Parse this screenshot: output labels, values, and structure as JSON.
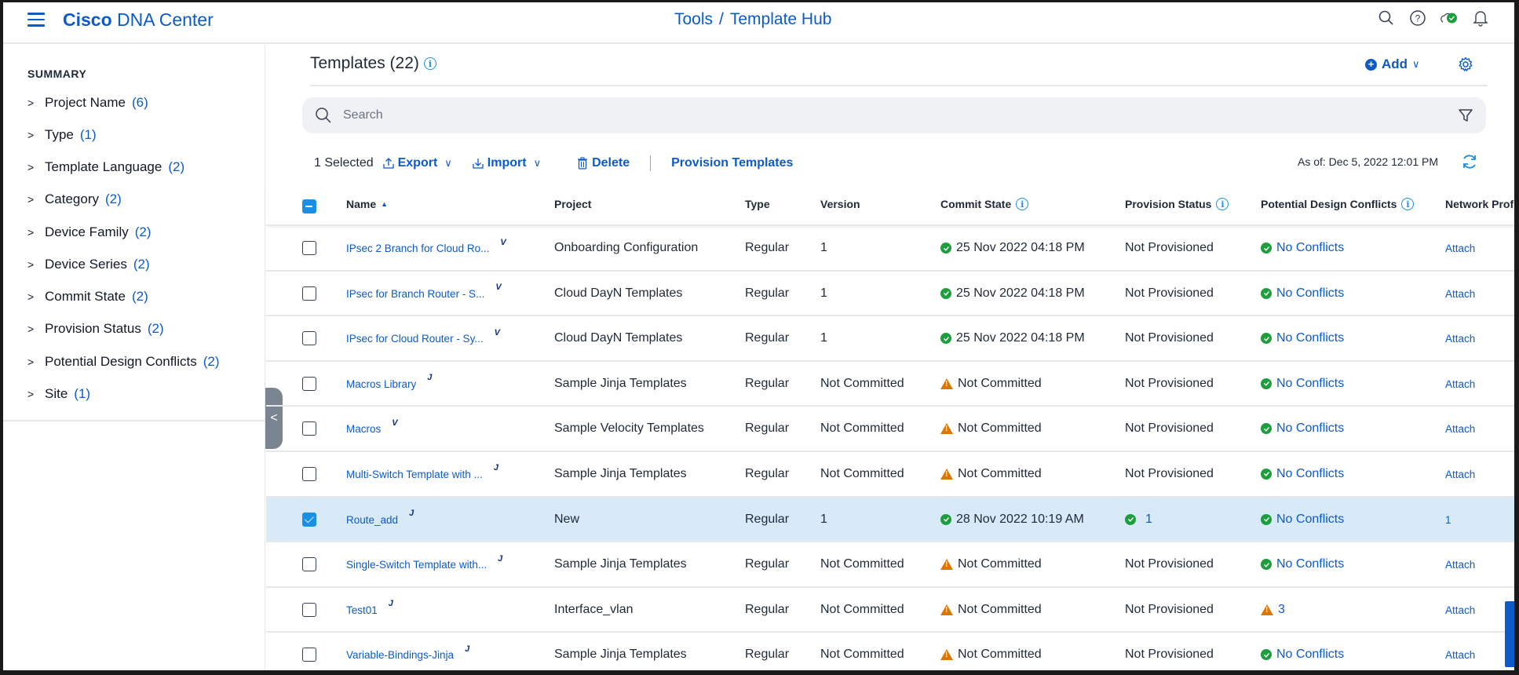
{
  "header": {
    "brand_bold": "Cisco",
    "brand_rest": " DNA Center",
    "breadcrumb_parent": "Tools",
    "breadcrumb_sep": "/",
    "breadcrumb_current": "Template Hub",
    "icons": [
      "search-icon",
      "help-icon",
      "cloud-status-icon",
      "notification-bell-icon"
    ]
  },
  "sidebar": {
    "title": "SUMMARY",
    "items": [
      {
        "label": "Project Name",
        "count": "(6)"
      },
      {
        "label": "Type",
        "count": "(1)"
      },
      {
        "label": "Template Language",
        "count": "(2)"
      },
      {
        "label": "Category",
        "count": "(2)"
      },
      {
        "label": "Device Family",
        "count": "(2)"
      },
      {
        "label": "Device Series",
        "count": "(2)"
      },
      {
        "label": "Commit State",
        "count": "(2)"
      },
      {
        "label": "Provision Status",
        "count": "(2)"
      },
      {
        "label": "Potential Design Conflicts",
        "count": "(2)"
      },
      {
        "label": "Site",
        "count": "(1)"
      }
    ],
    "collapse_glyph": "<"
  },
  "main": {
    "title": "Templates (22)",
    "add_label": "Add",
    "search_placeholder": "Search",
    "toolbar": {
      "selected": "1 Selected",
      "export": "Export",
      "import": "Import",
      "delete": "Delete",
      "provision": "Provision Templates"
    },
    "as_of": "As of: Dec 5, 2022 12:01 PM"
  },
  "table": {
    "columns": {
      "name": "Name",
      "project": "Project",
      "type": "Type",
      "version": "Version",
      "commit": "Commit State",
      "provision": "Provision Status",
      "conflicts": "Potential Design Conflicts",
      "profile": "Network Profile"
    },
    "sort": {
      "column": "Name",
      "direction": "ascending"
    },
    "rows": [
      {
        "name": "IPsec 2 Branch for Cloud Ro...",
        "lang": "V",
        "project": "Onboarding Configuration",
        "type": "Regular",
        "version": "1",
        "commit_status": "ok",
        "commit": "25 Nov 2022 04:18 PM",
        "prov_status": "none",
        "provision": "Not Provisioned",
        "conf_status": "ok",
        "conflicts": "No Conflicts",
        "profile": "Attach",
        "selected": false
      },
      {
        "name": "IPsec for Branch Router - S...",
        "lang": "V",
        "project": "Cloud DayN Templates",
        "type": "Regular",
        "version": "1",
        "commit_status": "ok",
        "commit": "25 Nov 2022 04:18 PM",
        "prov_status": "none",
        "provision": "Not Provisioned",
        "conf_status": "ok",
        "conflicts": "No Conflicts",
        "profile": "Attach",
        "selected": false
      },
      {
        "name": "IPsec for Cloud Router - Sy...",
        "lang": "V",
        "project": "Cloud DayN Templates",
        "type": "Regular",
        "version": "1",
        "commit_status": "ok",
        "commit": "25 Nov 2022 04:18 PM",
        "prov_status": "none",
        "provision": "Not Provisioned",
        "conf_status": "ok",
        "conflicts": "No Conflicts",
        "profile": "Attach",
        "selected": false
      },
      {
        "name": "Macros Library",
        "lang": "J",
        "project": "Sample Jinja Templates",
        "type": "Regular",
        "version": "Not Committed",
        "commit_status": "warn",
        "commit": "Not Committed",
        "prov_status": "none",
        "provision": "Not Provisioned",
        "conf_status": "ok",
        "conflicts": "No Conflicts",
        "profile": "Attach",
        "selected": false
      },
      {
        "name": "Macros",
        "lang": "V",
        "project": "Sample Velocity Templates",
        "type": "Regular",
        "version": "Not Committed",
        "commit_status": "warn",
        "commit": "Not Committed",
        "prov_status": "none",
        "provision": "Not Provisioned",
        "conf_status": "ok",
        "conflicts": "No Conflicts",
        "profile": "Attach",
        "selected": false
      },
      {
        "name": "Multi-Switch Template with ...",
        "lang": "J",
        "project": "Sample Jinja Templates",
        "type": "Regular",
        "version": "Not Committed",
        "commit_status": "warn",
        "commit": "Not Committed",
        "prov_status": "none",
        "provision": "Not Provisioned",
        "conf_status": "ok",
        "conflicts": "No Conflicts",
        "profile": "Attach",
        "selected": false
      },
      {
        "name": "Route_add",
        "lang": "J",
        "project": "New",
        "type": "Regular",
        "version": "1",
        "commit_status": "ok",
        "commit": "28 Nov 2022 10:19 AM",
        "prov_status": "ok",
        "provision": "1",
        "conf_status": "ok",
        "conflicts": "No Conflicts",
        "profile": "1",
        "selected": true
      },
      {
        "name": "Single-Switch Template with...",
        "lang": "J",
        "project": "Sample Jinja Templates",
        "type": "Regular",
        "version": "Not Committed",
        "commit_status": "warn",
        "commit": "Not Committed",
        "prov_status": "none",
        "provision": "Not Provisioned",
        "conf_status": "ok",
        "conflicts": "No Conflicts",
        "profile": "Attach",
        "selected": false
      },
      {
        "name": "Test01",
        "lang": "J",
        "project": "Interface_vlan",
        "type": "Regular",
        "version": "Not Committed",
        "commit_status": "warn",
        "commit": "Not Committed",
        "prov_status": "none",
        "provision": "Not Provisioned",
        "conf_status": "warn",
        "conflicts": "3",
        "profile": "Attach",
        "selected": false
      },
      {
        "name": "Variable-Bindings-Jinja",
        "lang": "J",
        "project": "Sample Jinja Templates",
        "type": "Regular",
        "version": "Not Committed",
        "commit_status": "warn",
        "commit": "Not Committed",
        "prov_status": "none",
        "provision": "Not Provisioned",
        "conf_status": "ok",
        "conflicts": "No Conflicts",
        "profile": "Attach",
        "selected": false
      }
    ]
  }
}
